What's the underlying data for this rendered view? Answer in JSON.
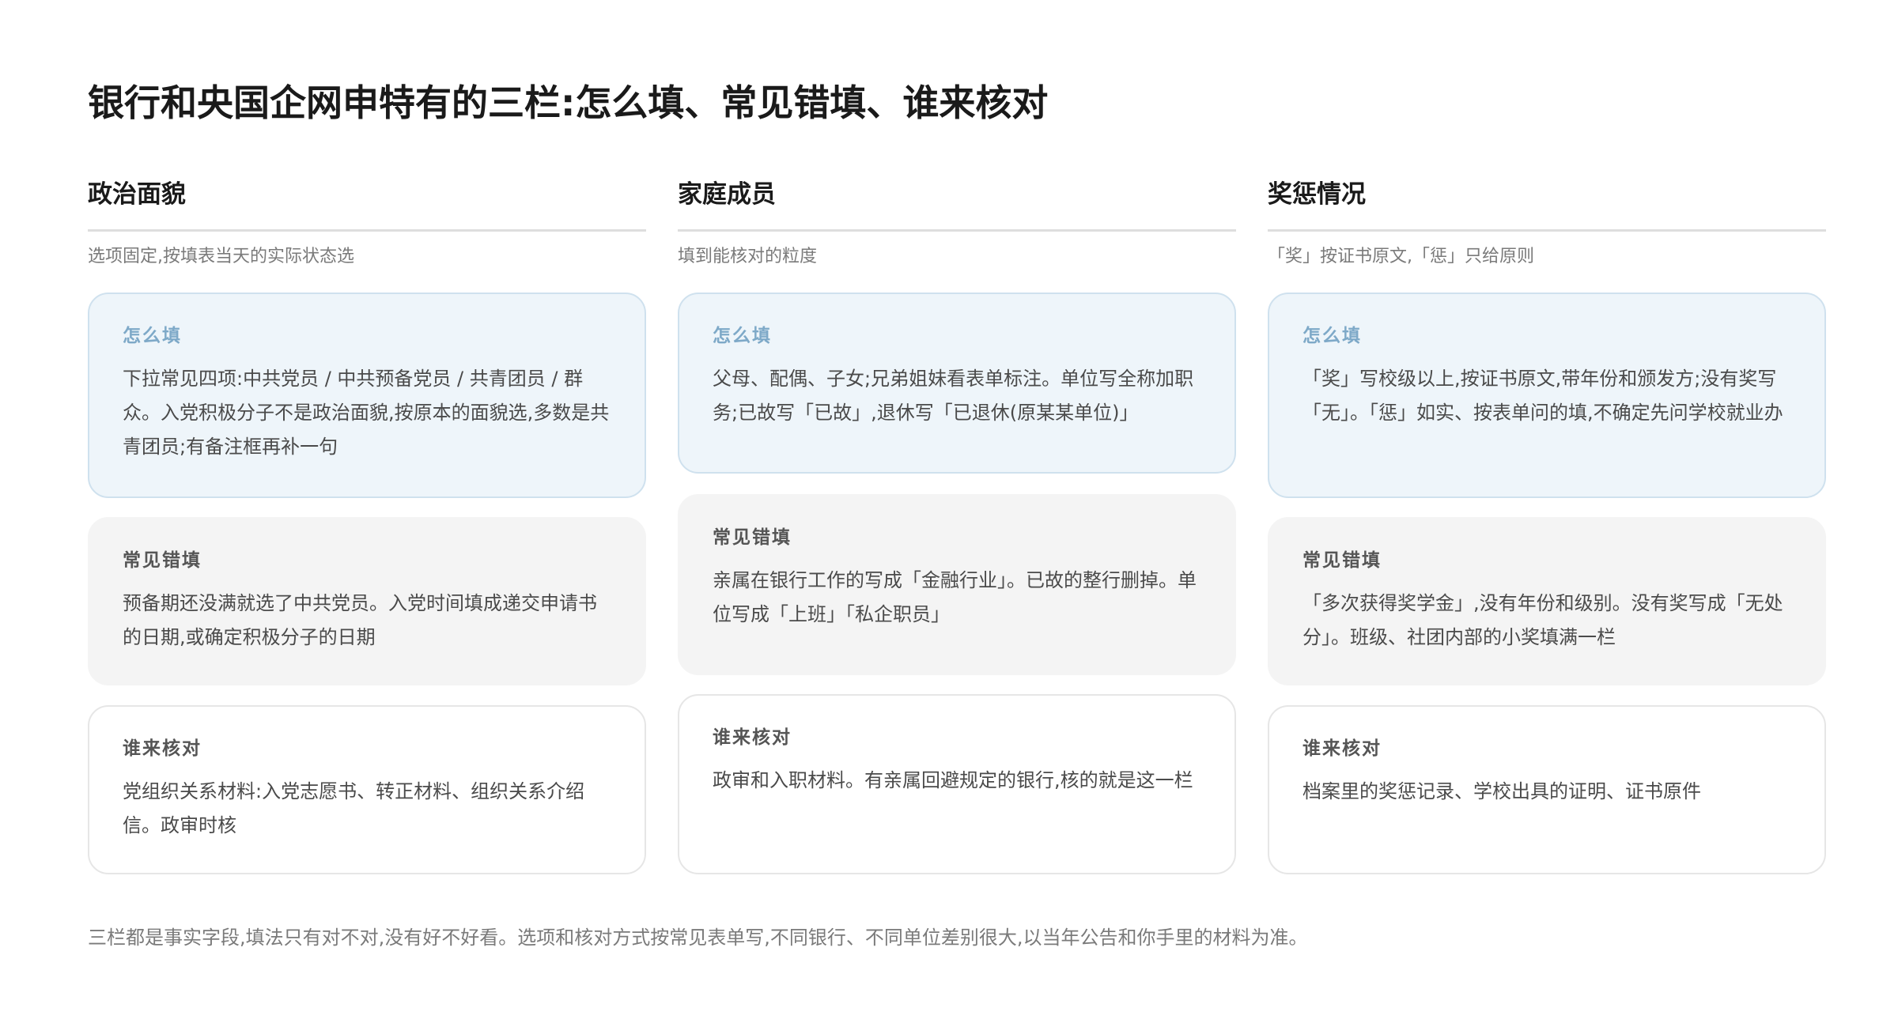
{
  "title": "银行和央国企网申特有的三栏:怎么填、常见错填、谁来核对",
  "columns": [
    {
      "heading": "政治面貌",
      "subtitle": "选项固定,按填表当天的实际状态选",
      "fill": {
        "label": "怎么填",
        "text": "下拉常见四项:中共党员 / 中共预备党员 / 共青团员 / 群众。入党积极分子不是政治面貌,按原本的面貌选,多数是共青团员;有备注框再补一句"
      },
      "mistake": {
        "label": "常见错填",
        "text": "预备期还没满就选了中共党员。入党时间填成递交申请书的日期,或确定积极分子的日期"
      },
      "verify": {
        "label": "谁来核对",
        "text": "党组织关系材料:入党志愿书、转正材料、组织关系介绍信。政审时核"
      }
    },
    {
      "heading": "家庭成员",
      "subtitle": "填到能核对的粒度",
      "fill": {
        "label": "怎么填",
        "text": "父母、配偶、子女;兄弟姐妹看表单标注。单位写全称加职务;已故写「已故」,退休写「已退休(原某某单位)」"
      },
      "mistake": {
        "label": "常见错填",
        "text": "亲属在银行工作的写成「金融行业」。已故的整行删掉。单位写成「上班」「私企职员」"
      },
      "verify": {
        "label": "谁来核对",
        "text": "政审和入职材料。有亲属回避规定的银行,核的就是这一栏"
      }
    },
    {
      "heading": "奖惩情况",
      "subtitle": "「奖」按证书原文,「惩」只给原则",
      "fill": {
        "label": "怎么填",
        "text": "「奖」写校级以上,按证书原文,带年份和颁发方;没有奖写「无」。「惩」如实、按表单问的填,不确定先问学校就业办"
      },
      "mistake": {
        "label": "常见错填",
        "text": "「多次获得奖学金」,没有年份和级别。没有奖写成「无处分」。班级、社团内部的小奖填满一栏"
      },
      "verify": {
        "label": "谁来核对",
        "text": "档案里的奖惩记录、学校出具的证明、证书原件"
      }
    }
  ],
  "footer": "三栏都是事实字段,填法只有对不对,没有好不好看。选项和核对方式按常见表单写,不同银行、不同单位差别很大,以当年公告和你手里的材料为准。"
}
